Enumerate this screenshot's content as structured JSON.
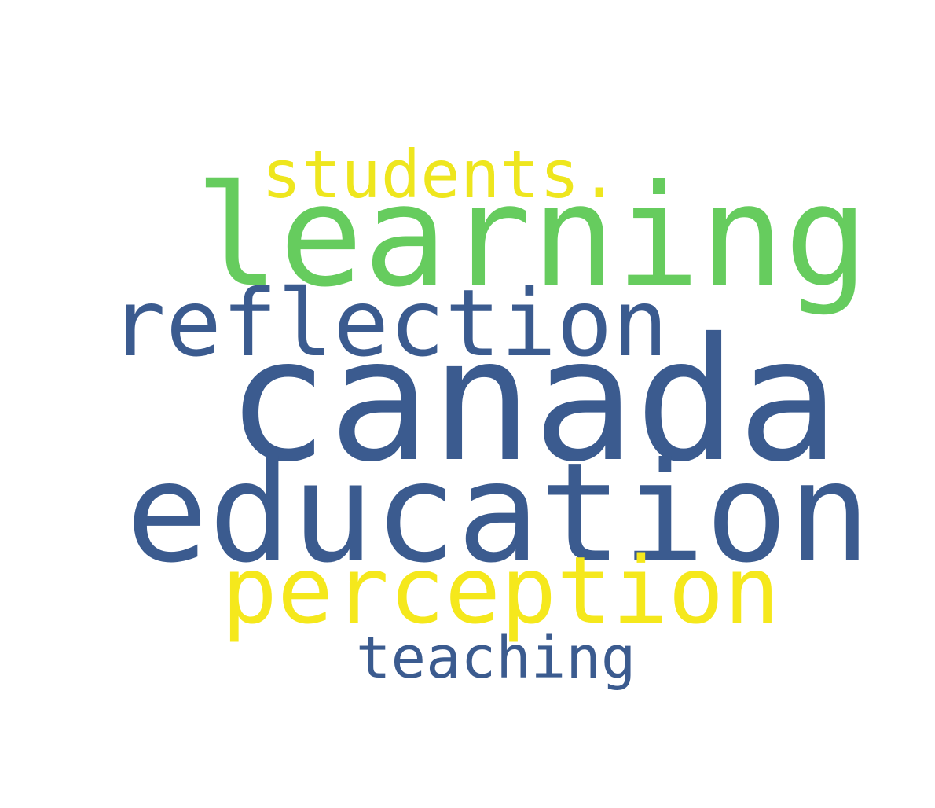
{
  "word_cloud": {
    "background": "#ffffff",
    "colors": {
      "dark_blue": "#3b5b8f",
      "green": "#66cc5e",
      "yellow": "#f5e81c",
      "yellow_light": "#eee61e"
    },
    "words": [
      {
        "text": "canada",
        "color": "#3b5b8f"
      },
      {
        "text": "education",
        "color": "#3b5b8f"
      },
      {
        "text": "learning",
        "color": "#66cc5e"
      },
      {
        "text": "reflection",
        "color": "#3b5b8f"
      },
      {
        "text": "perception",
        "color": "#f5e81c"
      },
      {
        "text": "students.",
        "color": "#eee61e"
      },
      {
        "text": "teaching",
        "color": "#3b5b8f"
      }
    ]
  }
}
